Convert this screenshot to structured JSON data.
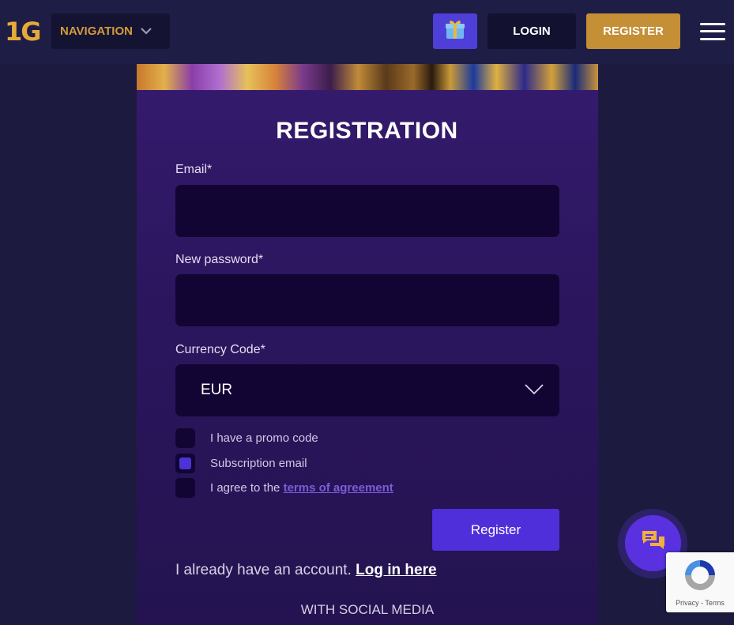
{
  "header": {
    "logo": "1G",
    "nav_label": "NAVIGATION",
    "gift_icon": "gift-icon",
    "login_label": "LOGIN",
    "register_label": "REGISTER",
    "menu_icon": "hamburger-menu-icon"
  },
  "form": {
    "title": "REGISTRATION",
    "email_label": "Email*",
    "email_value": "",
    "password_label": "New password*",
    "password_value": "",
    "currency_label": "Currency Code*",
    "currency_value": "EUR",
    "checkboxes": [
      {
        "label": "I have a promo code",
        "checked": false
      },
      {
        "label": "Subscription email",
        "checked": true
      },
      {
        "label": "I agree to the ",
        "link": "terms of agreement",
        "checked": false
      }
    ],
    "submit_label": "Register",
    "account_text": "I already have an account.",
    "login_link": "Log in here",
    "social_title": "WITH SOCIAL MEDIA"
  },
  "widgets": {
    "chat_icon": "chat-icon",
    "recaptcha_text": "Privacy - Terms"
  },
  "colors": {
    "background": "#1c1b3f",
    "panel": "#2b165e",
    "accent_purple": "#4f2fd9",
    "accent_gold": "#c48f35",
    "input_bg": "#130533"
  }
}
